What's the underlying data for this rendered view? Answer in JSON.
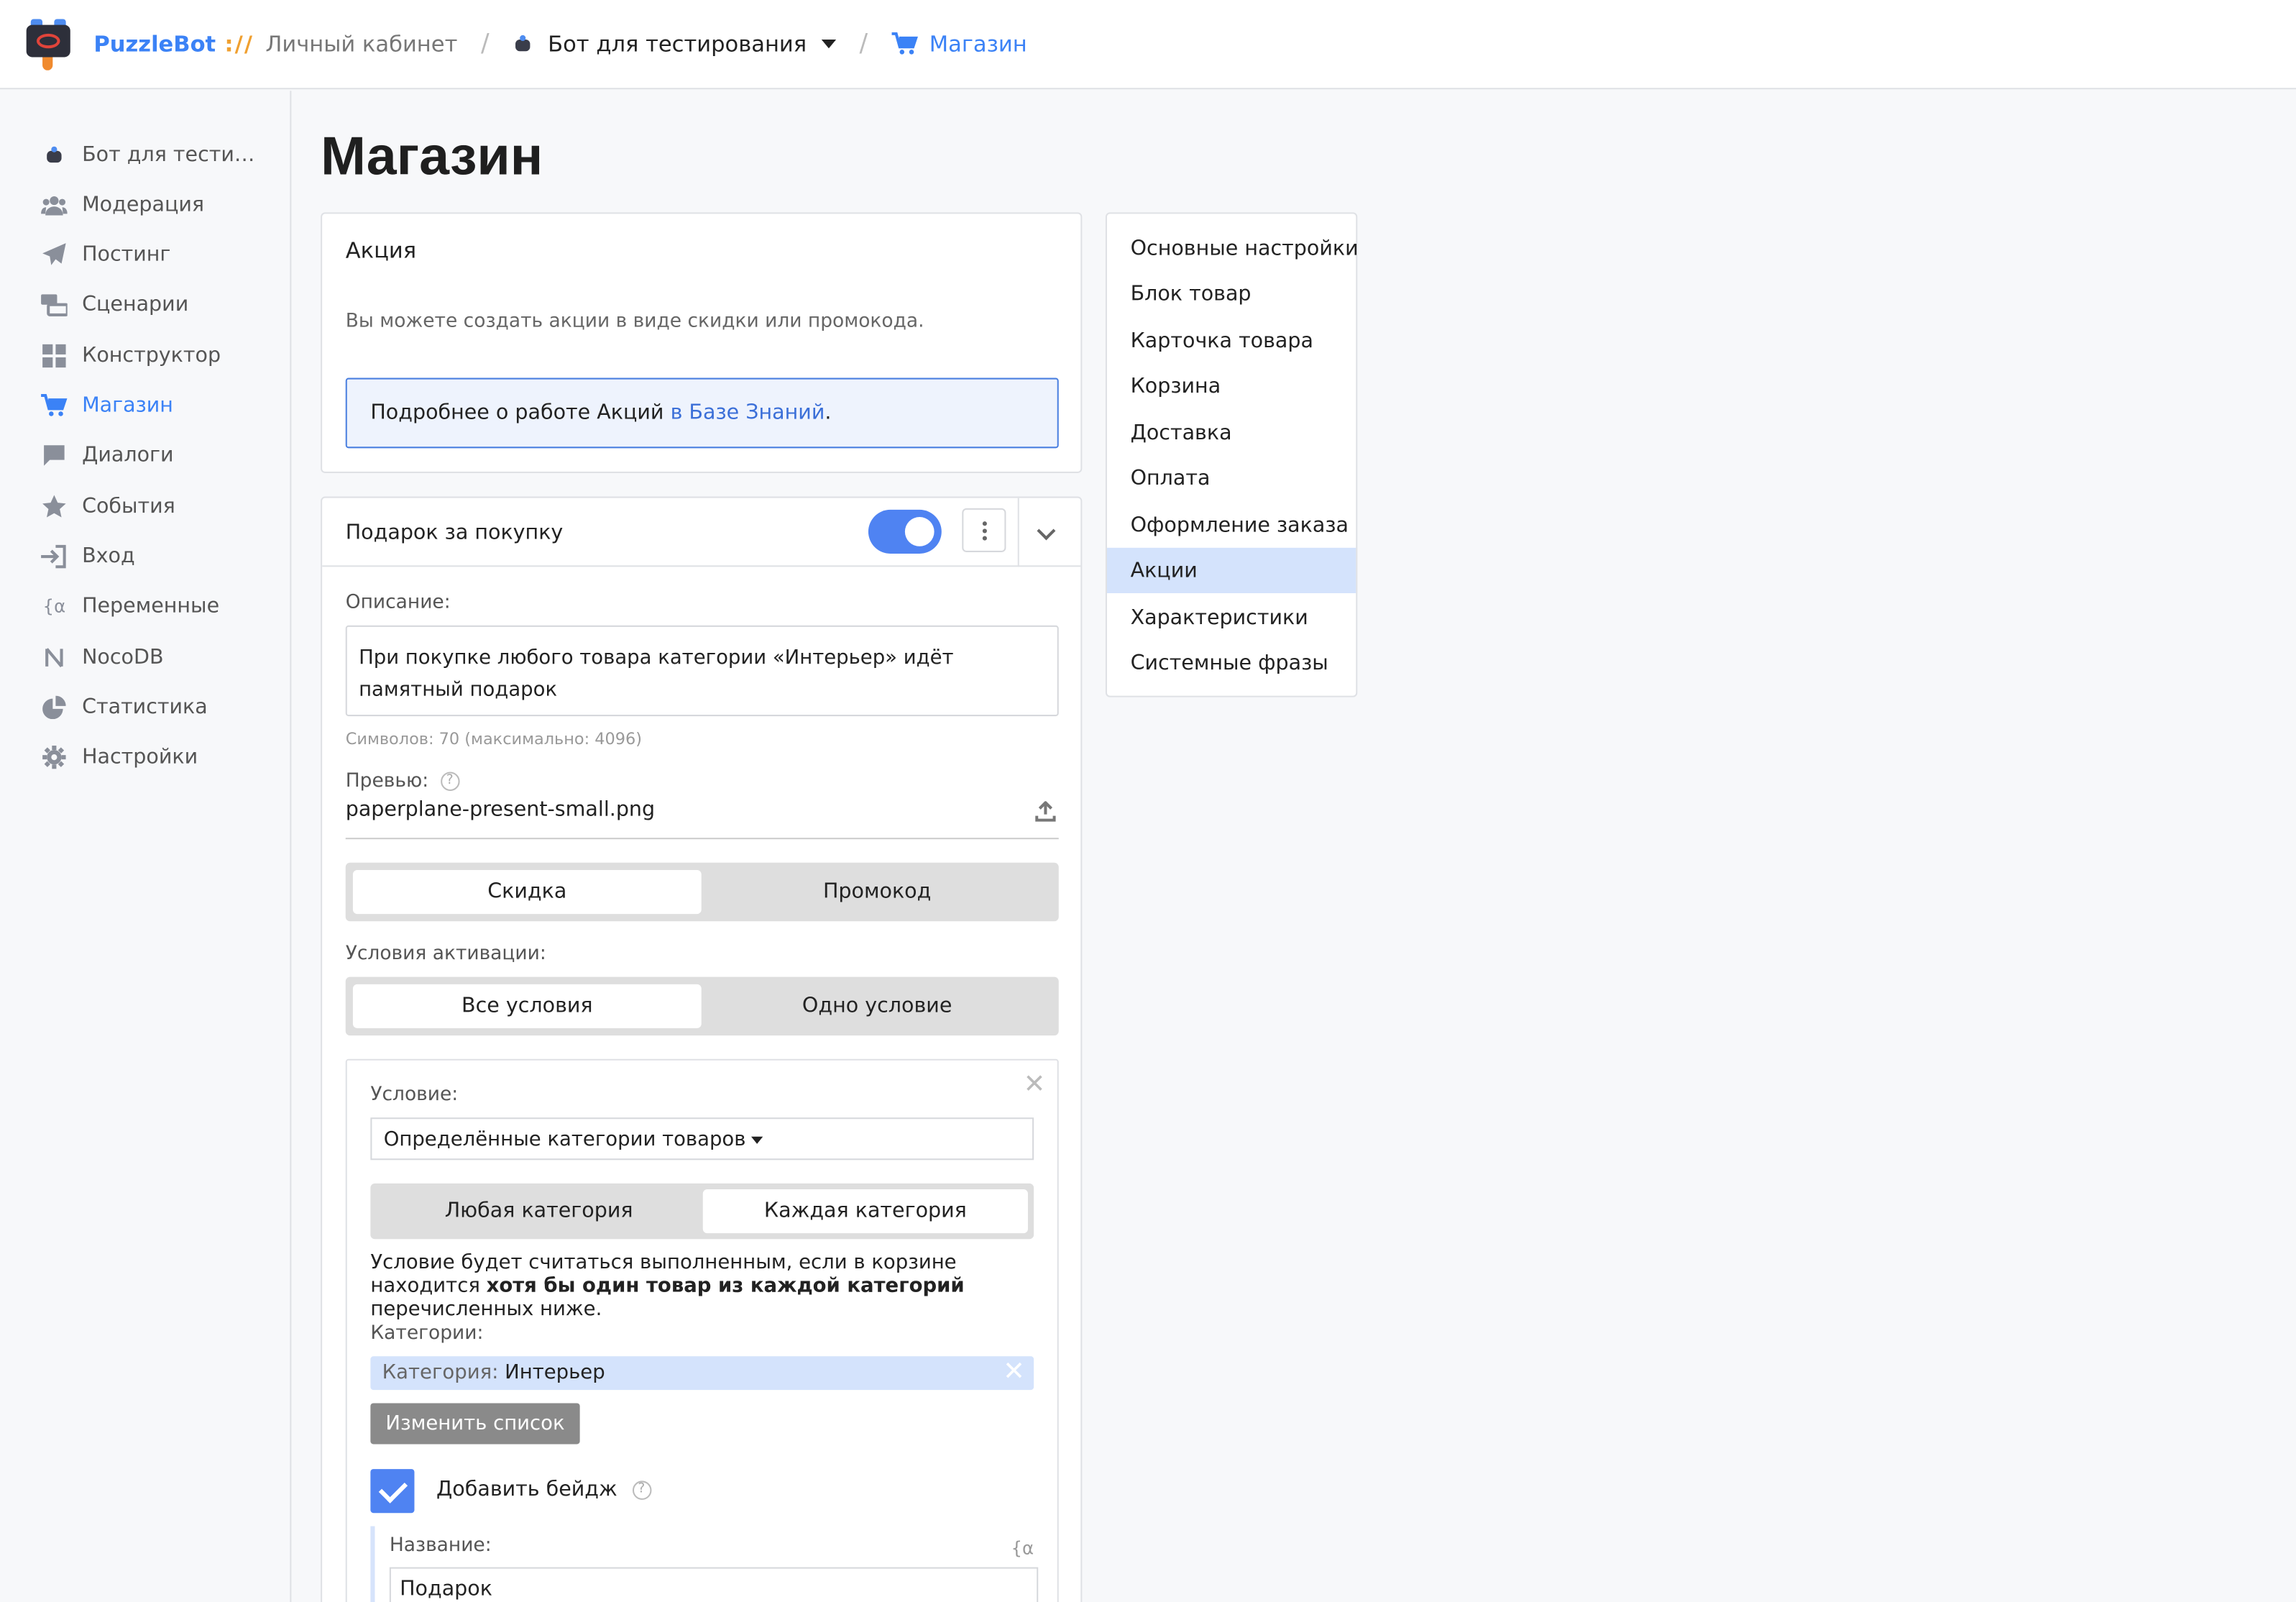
{
  "topbar": {
    "brand": "PuzzleBot",
    "brand_sep": "://",
    "cabinet": "Личный кабинет",
    "bot": "Бот для тестирования",
    "section": "Магазин"
  },
  "sidebar": {
    "items": [
      {
        "label": "Бот для тести…",
        "icon": "bot-icon"
      },
      {
        "label": "Модерация",
        "icon": "users-icon"
      },
      {
        "label": "Постинг",
        "icon": "paper-plane-icon"
      },
      {
        "label": "Сценарии",
        "icon": "scenarios-icon"
      },
      {
        "label": "Конструктор",
        "icon": "grid-icon"
      },
      {
        "label": "Магазин",
        "icon": "cart-icon",
        "active": true
      },
      {
        "label": "Диалоги",
        "icon": "chat-icon"
      },
      {
        "label": "События",
        "icon": "star-icon"
      },
      {
        "label": "Вход",
        "icon": "sign-in-icon"
      },
      {
        "label": "Переменные",
        "icon": "variable-icon"
      },
      {
        "label": "NocoDB",
        "icon": "nocodb-icon"
      },
      {
        "label": "Статистика",
        "icon": "pie-chart-icon"
      },
      {
        "label": "Настройки",
        "icon": "gear-icon"
      }
    ]
  },
  "main": {
    "title": "Магазин",
    "promo_card": {
      "heading": "Акция",
      "description": "Вы можете создать акции в виде скидки или промокода.",
      "info_prefix": "Подробнее о работе Акций ",
      "info_link": "в Базе Знаний",
      "info_suffix": "."
    },
    "promo": {
      "name": "Подарок за покупку",
      "enabled": true,
      "description_label": "Описание:",
      "description": "При покупке любого товара категории «Интерьер» идёт памятный подарок",
      "counter": "Символов: 70 (максимально: 4096)",
      "preview_label": "Превью:",
      "preview_file": "paperplane-present-small.png",
      "type_options": [
        "Скидка",
        "Промокод"
      ],
      "type_selected": "Скидка",
      "activation_label": "Условия активации:",
      "activation_options": [
        "Все условия",
        "Одно условие"
      ],
      "activation_selected": "Все условия",
      "condition": {
        "label": "Условие:",
        "select_value": "Определённые категории товаров",
        "mode_options": [
          "Любая категория",
          "Каждая категория"
        ],
        "mode_selected": "Каждая категория",
        "text_prefix": "Условие будет считаться выполненным, если в корзине находится ",
        "text_bold": "хотя бы один товар из каждой категорий",
        "text_suffix": " перечисленных ниже.",
        "categories_label": "Категории:",
        "chip_key": "Категория:",
        "chip_value": "Интерьер",
        "change_list": "Изменить список",
        "badge_checked": true,
        "badge_label": "Добавить бейдж",
        "name_label": "Название:",
        "name_value": "Подарок"
      }
    }
  },
  "right_nav": {
    "items": [
      "Основные настройки",
      "Блок товар",
      "Карточка товара",
      "Корзина",
      "Доставка",
      "Оплата",
      "Оформление заказа",
      "Акции",
      "Характеристики",
      "Системные фразы"
    ],
    "active": "Акции"
  },
  "colors": {
    "accent": "#3b82f6",
    "toggle": "#4f83f2",
    "highlight": "#d4e3fc"
  }
}
